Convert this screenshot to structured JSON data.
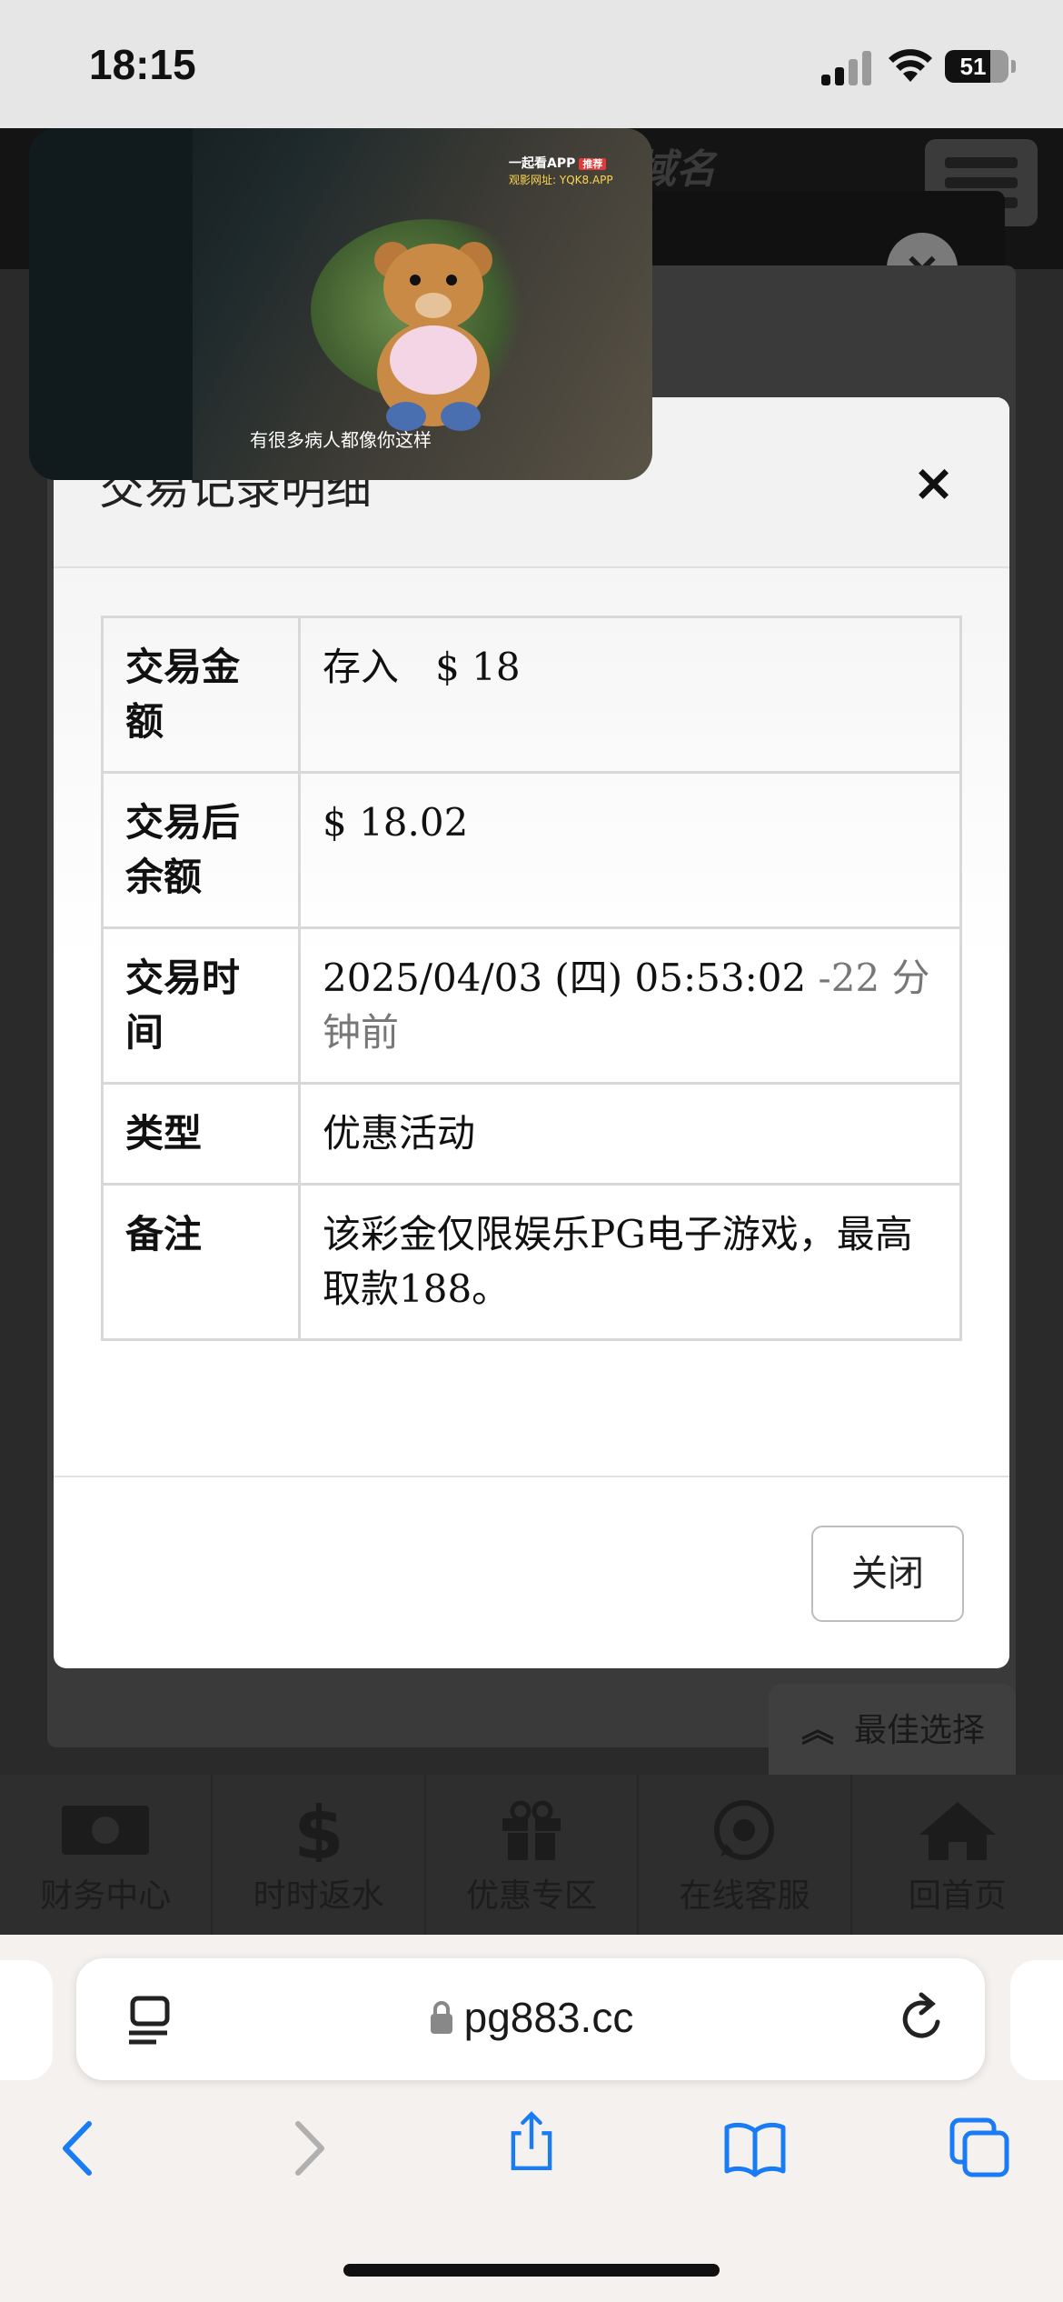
{
  "status_bar": {
    "time": "18:15",
    "battery": "51"
  },
  "background": {
    "site_title_ghost": "域名",
    "best_choice": "最佳选择",
    "nav": [
      {
        "label": "财务中心",
        "icon": "money-icon"
      },
      {
        "label": "时时返水",
        "icon": "dollar-icon"
      },
      {
        "label": "优惠专区",
        "icon": "gift-icon"
      },
      {
        "label": "在线客服",
        "icon": "whatsapp-icon"
      },
      {
        "label": "回首页",
        "icon": "home-icon"
      }
    ]
  },
  "video": {
    "brand": "一起看APP",
    "badge": "推荐",
    "url": "观影网址: YQK8.APP",
    "subtitle": "有很多病人都像你这样"
  },
  "modal": {
    "title": "交易记录明细",
    "close_x": "×",
    "rows": [
      {
        "key": "交易金额",
        "val_type": "存入",
        "val_amount": "$ 18"
      },
      {
        "key": "交易后余额",
        "val": "$ 18.02"
      },
      {
        "key": "交易时间",
        "val": "2025/04/03 (四) 05:53:02",
        "val_rel": "-22 分钟前"
      },
      {
        "key": "类型",
        "val": "优惠活动"
      },
      {
        "key": "备注",
        "val": "该彩金仅限娱乐PG电子游戏，最高取款188。"
      }
    ],
    "close_button": "关闭"
  },
  "safari": {
    "url": "pg883.cc"
  },
  "colors": {
    "deposit_green": "#2e7d32",
    "safari_blue": "#1a7cf5"
  }
}
